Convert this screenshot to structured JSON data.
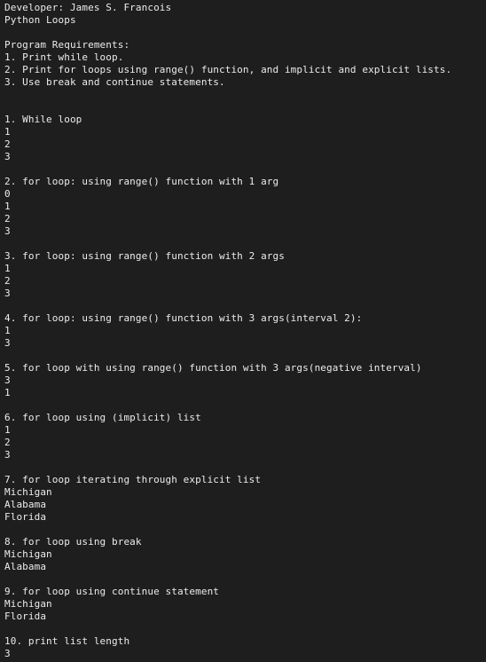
{
  "terminal": {
    "lines": [
      "Developer: James S. Francois",
      "Python Loops",
      "",
      "Program Requirements:",
      "1. Print while loop.",
      "2. Print for loops using range() function, and implicit and explicit lists.",
      "3. Use break and continue statements.",
      "",
      "",
      "1. While loop",
      "1",
      "2",
      "3",
      "",
      "2. for loop: using range() function with 1 arg",
      "0",
      "1",
      "2",
      "3",
      "",
      "3. for loop: using range() function with 2 args",
      "1",
      "2",
      "3",
      "",
      "4. for loop: using range() function with 3 args(interval 2):",
      "1",
      "3",
      "",
      "5. for loop with using range() function with 3 args(negative interval)",
      "3",
      "1",
      "",
      "6. for loop using (implicit) list",
      "1",
      "2",
      "3",
      "",
      "7. for loop iterating through explicit list",
      "Michigan",
      "Alabama",
      "Florida",
      "",
      "8. for loop using break",
      "Michigan",
      "Alabama",
      "",
      "9. for loop using continue statement",
      "Michigan",
      "Florida",
      "",
      "10. print list length",
      "3"
    ]
  }
}
